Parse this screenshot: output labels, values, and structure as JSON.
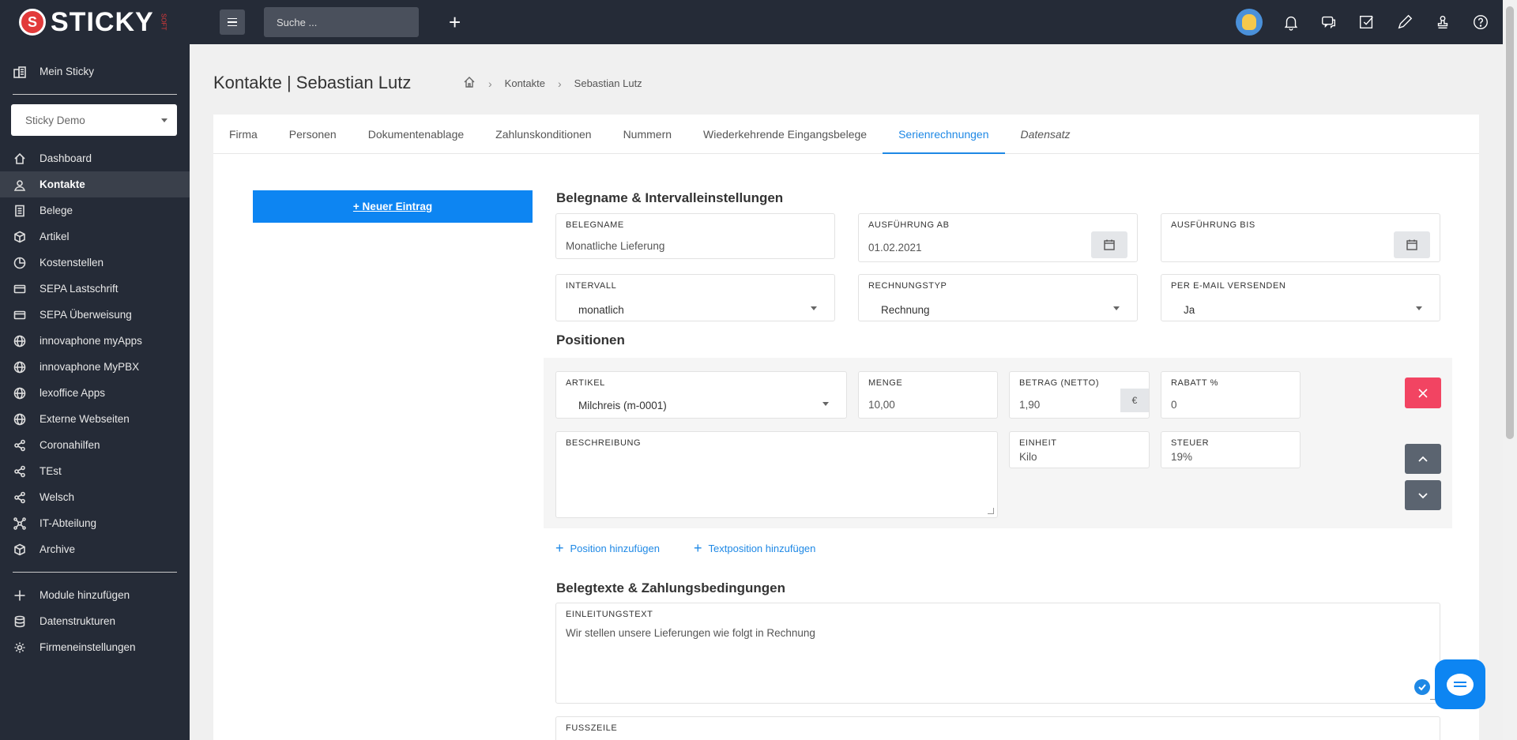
{
  "app": {
    "logo_mark": "S",
    "logo_text": "STICKY",
    "logo_sub": "SOFT"
  },
  "sidebar": {
    "home_label": "Mein Sticky",
    "company_select": "Sticky Demo",
    "items": [
      {
        "label": "Dashboard",
        "icon": "home-icon"
      },
      {
        "label": "Kontakte",
        "icon": "contacts-icon"
      },
      {
        "label": "Belege",
        "icon": "document-icon"
      },
      {
        "label": "Artikel",
        "icon": "box-icon"
      },
      {
        "label": "Kostenstellen",
        "icon": "pie-icon"
      },
      {
        "label": "SEPA Lastschrift",
        "icon": "card-icon"
      },
      {
        "label": "SEPA Überweisung",
        "icon": "card-icon"
      },
      {
        "label": "innovaphone myApps",
        "icon": "globe-icon"
      },
      {
        "label": "innovaphone MyPBX",
        "icon": "globe-icon"
      },
      {
        "label": "lexoffice Apps",
        "icon": "globe-icon"
      },
      {
        "label": "Externe Webseiten",
        "icon": "globe-icon"
      },
      {
        "label": "Coronahilfen",
        "icon": "share-icon"
      },
      {
        "label": "TEst",
        "icon": "share-icon"
      },
      {
        "label": "Welsch",
        "icon": "share-icon"
      },
      {
        "label": "IT-Abteilung",
        "icon": "network-icon"
      },
      {
        "label": "Archive",
        "icon": "box-icon"
      }
    ],
    "bottom_items": [
      {
        "label": "Module hinzufügen",
        "icon": "plus-icon"
      },
      {
        "label": "Datenstrukturen",
        "icon": "database-icon"
      },
      {
        "label": "Firmeneinstellungen",
        "icon": "gear-icon"
      }
    ]
  },
  "topbar": {
    "search_placeholder": "Suche ...",
    "add_label": "+"
  },
  "page": {
    "title": "Kontakte | Sebastian Lutz",
    "breadcrumb": [
      "Kontakte",
      "Sebastian Lutz"
    ]
  },
  "tabs": [
    {
      "label": "Firma"
    },
    {
      "label": "Personen"
    },
    {
      "label": "Dokumentenablage"
    },
    {
      "label": "Zahlunskonditionen"
    },
    {
      "label": "Nummern"
    },
    {
      "label": "Wiederkehrende Eingangsbelege"
    },
    {
      "label": "Serienrechnungen"
    },
    {
      "label": "Datensatz"
    }
  ],
  "form": {
    "new_entry_label": "+ Neuer Eintrag",
    "section1_title": "Belegname & Intervalleinstellungen",
    "belegname_label": "BELEGNAME",
    "belegname_value": "Monatliche Lieferung",
    "ausfuehrung_ab_label": "AUSFÜHRUNG AB",
    "ausfuehrung_ab_value": "01.02.2021",
    "ausfuehrung_bis_label": "AUSFÜHRUNG BIS",
    "ausfuehrung_bis_value": "",
    "intervall_label": "INTERVALL",
    "intervall_value": "monatlich",
    "rechnungstyp_label": "RECHNUNGSTYP",
    "rechnungstyp_value": "Rechnung",
    "email_label": "PER E-MAIL VERSENDEN",
    "email_value": "Ja",
    "section2_title": "Positionen",
    "artikel_label": "ARTIKEL",
    "artikel_value": "Milchreis (m-0001)",
    "menge_label": "MENGE",
    "menge_value": "10,00",
    "betrag_label": "BETRAG (NETTO)",
    "betrag_value": "1,90",
    "currency": "€",
    "rabatt_label": "RABATT %",
    "rabatt_value": "0",
    "beschreibung_label": "BESCHREIBUNG",
    "einheit_label": "EINHEIT",
    "einheit_value": "Kilo",
    "steuer_label": "STEUER",
    "steuer_value": "19%",
    "add_position_label": "Position hinzufügen",
    "add_textposition_label": "Textposition hinzufügen",
    "section3_title": "Belegtexte & Zahlungsbedingungen",
    "einleitung_label": "EINLEITUNGSTEXT",
    "einleitung_value": "Wir stellen unsere Lieferungen wie folgt in Rechnung",
    "fusszeile_label": "FUSSZEILE"
  },
  "colors": {
    "sidebar_bg": "#252b37",
    "accent": "#0d85f2",
    "danger": "#f24462"
  }
}
